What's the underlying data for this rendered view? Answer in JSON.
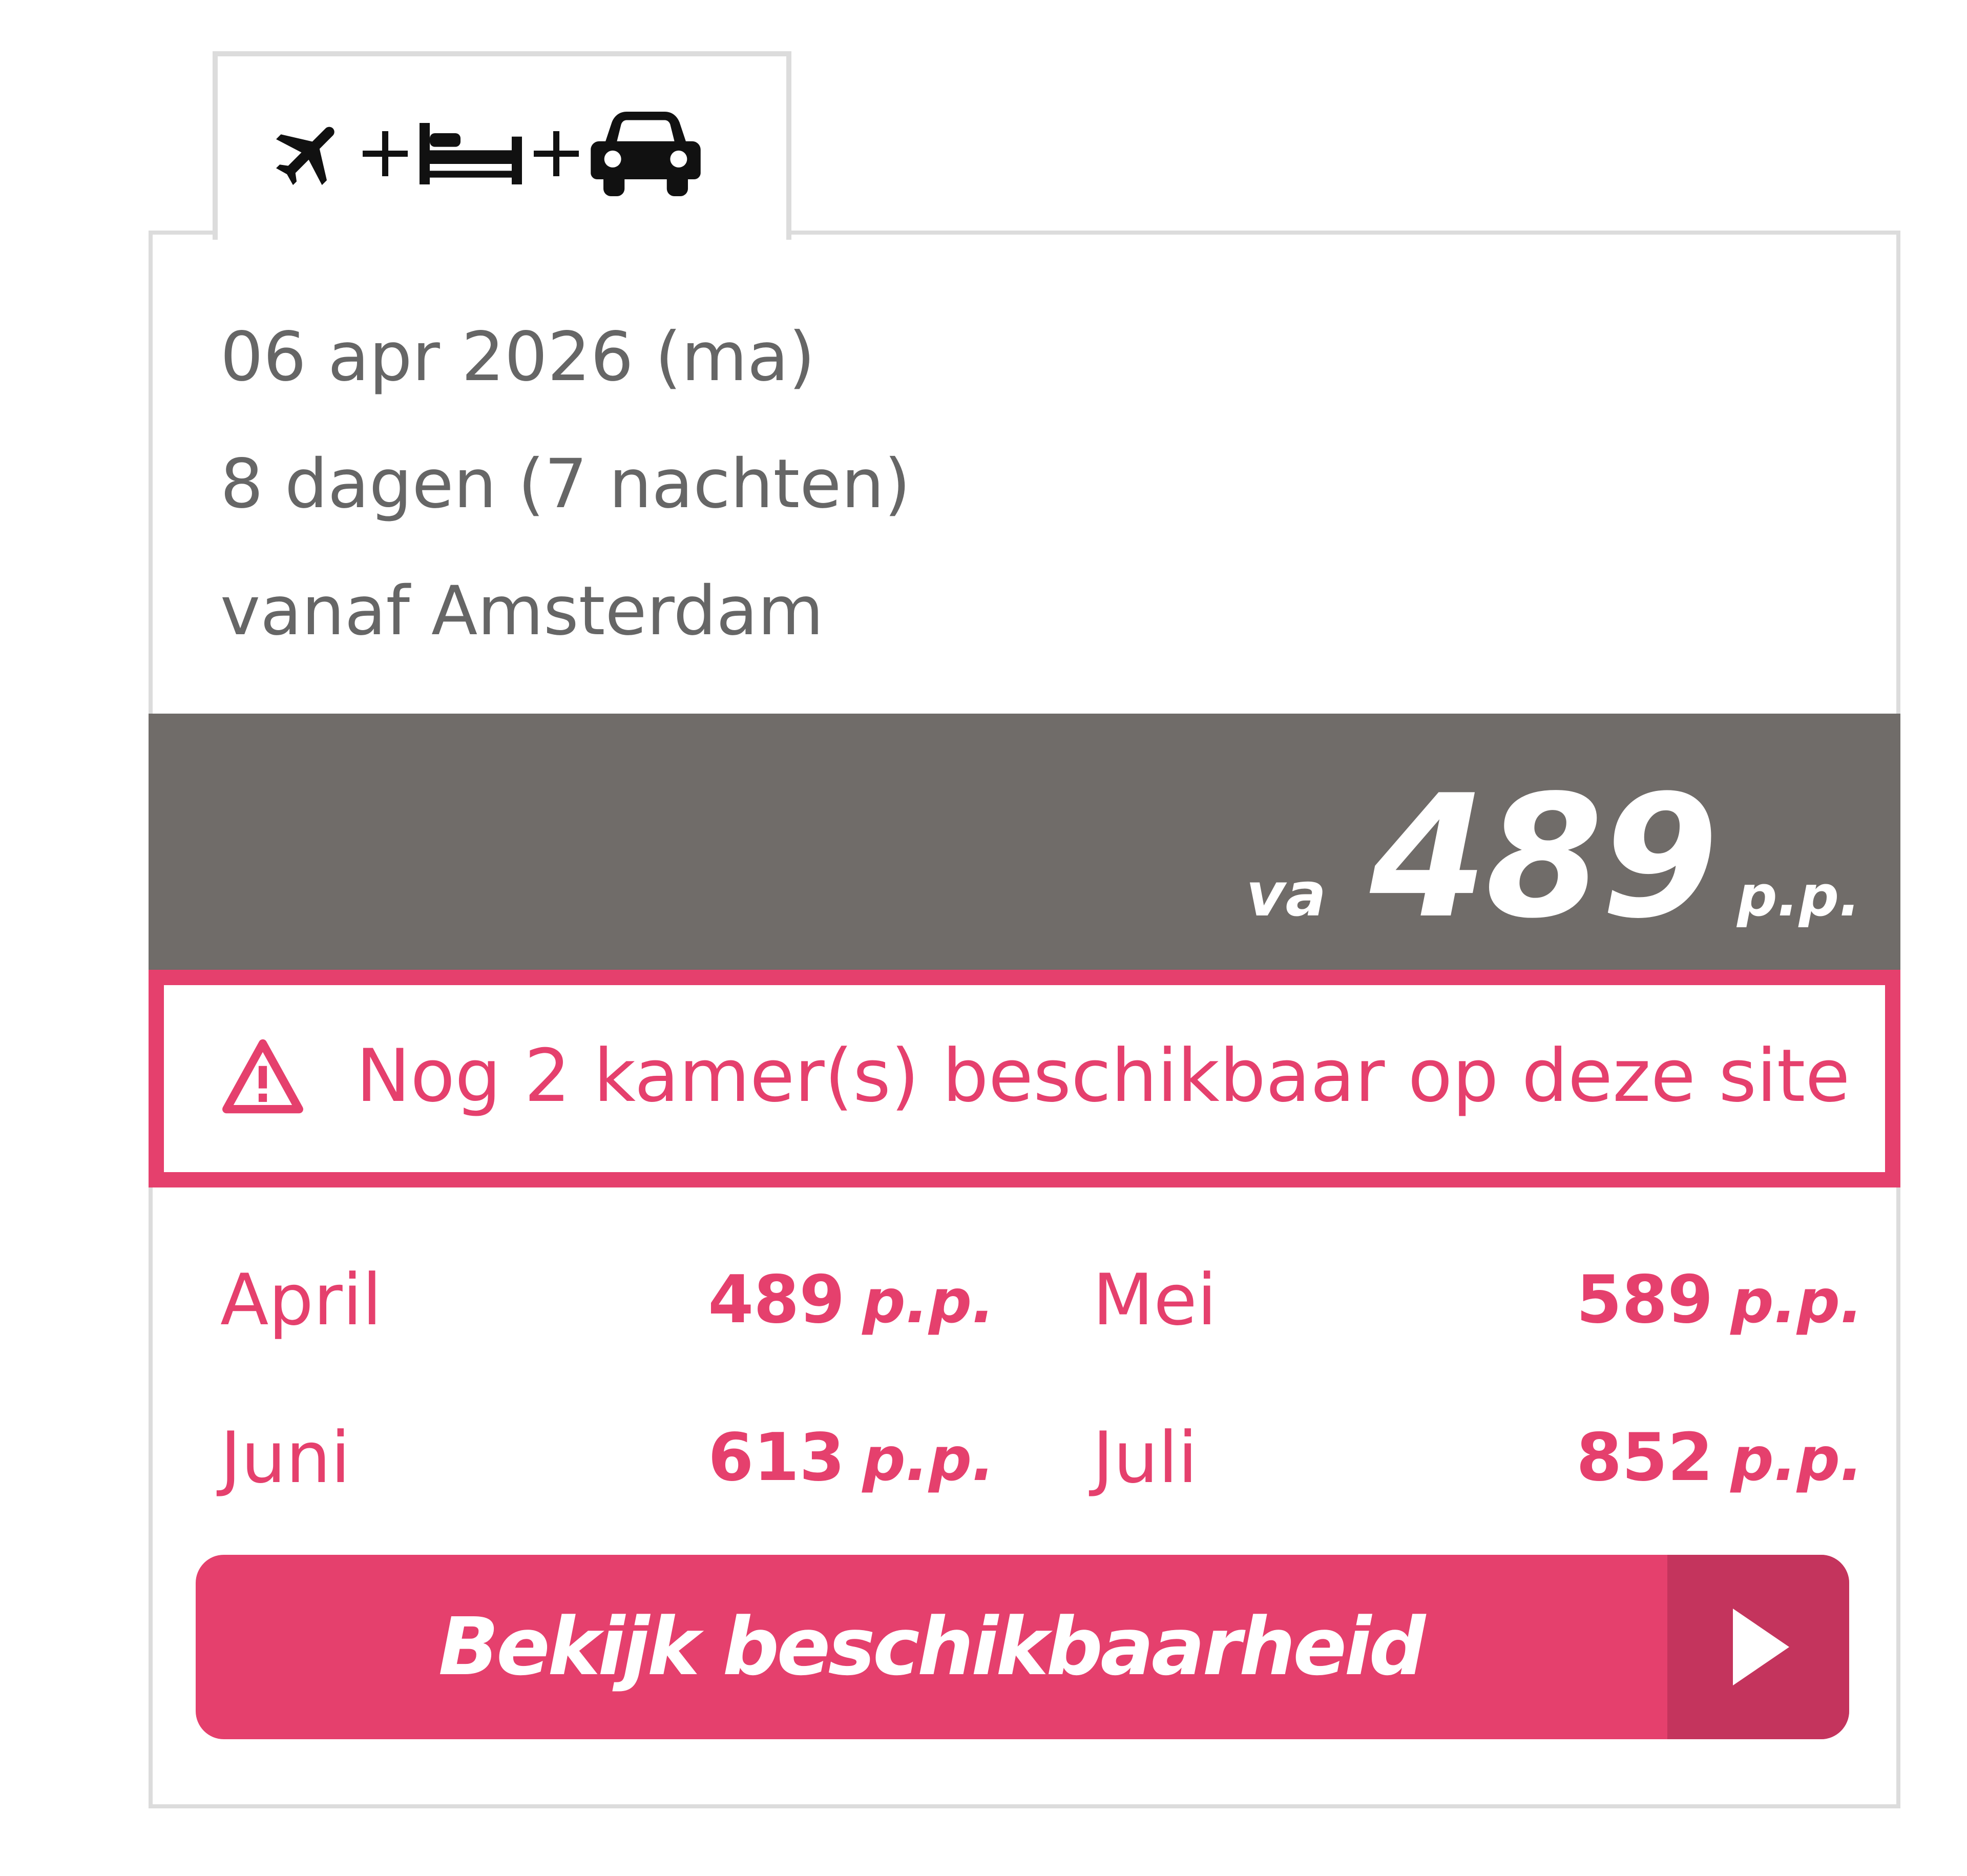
{
  "tab": {
    "icons": [
      "plane-icon",
      "bed-icon",
      "car-icon"
    ],
    "separator": "+"
  },
  "trip": {
    "date": "06 apr 2026 (ma)",
    "duration": "8 dagen (7 nachten)",
    "departure": "vanaf Amsterdam"
  },
  "price": {
    "prefix": "va",
    "amount": "489",
    "suffix": "p.p."
  },
  "warning": {
    "icon": "warning-icon",
    "text": "Nog 2 kamer(s) beschikbaar op deze site"
  },
  "months": [
    {
      "label": "April",
      "price": "489",
      "suffix": "p.p."
    },
    {
      "label": "Mei",
      "price": "589",
      "suffix": "p.p."
    },
    {
      "label": "Juni",
      "price": "613",
      "suffix": "p.p."
    },
    {
      "label": "Juli",
      "price": "852",
      "suffix": "p.p."
    }
  ],
  "cta": {
    "label": "Bekijk beschikbaarheid",
    "icon": "play-arrow-icon"
  },
  "colors": {
    "accent": "#e5406d",
    "accent_dark": "#c4345d",
    "price_band": "#706c69",
    "text_gray": "#666666",
    "border": "#dcdcdc"
  }
}
